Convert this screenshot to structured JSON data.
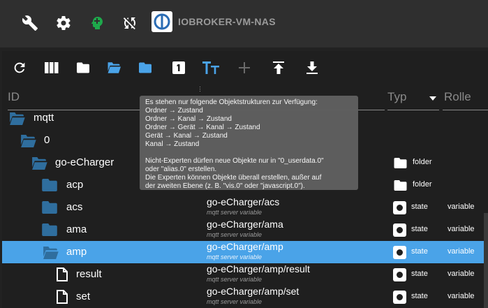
{
  "topbar": {
    "icons": [
      "wrench-icon",
      "gear-icon",
      "head-profile-icon",
      "sync-disabled-icon"
    ],
    "title": "IOBROKER-VM-NAS"
  },
  "toolbar": {
    "buttons": [
      "refresh-icon",
      "columns-icon",
      "folder-closed-icon",
      "folder-open-icon",
      "folder-icon",
      "number-one-icon",
      "text-size-icon",
      "add-icon",
      "upload-icon",
      "download-icon"
    ]
  },
  "header": {
    "id": "ID",
    "typ": "Typ",
    "rolle": "Rolle"
  },
  "tooltip": {
    "lines": [
      "Es stehen nur folgende Objektstrukturen zur Verfügung:",
      "Ordner → Zustand",
      "Ordner → Kanal → Zustand",
      "Ordner → Gerät → Kanal → Zustand",
      "Gerät → Kanal → Zustand",
      "Kanal → Zustand",
      "",
      "Nicht-Experten dürfen neue Objekte nur in \"0_userdata.0\"",
      "oder \"alias.0\" erstellen.",
      "Die Experten können Objekte überall erstellen, außer auf",
      "der zweiten Ebene (z. B. \"vis.0\" oder \"javascript.0\")."
    ]
  },
  "rows": [
    {
      "label": "mqtt",
      "name": "",
      "desc": "",
      "type": "",
      "role": ""
    },
    {
      "label": "0",
      "name": "",
      "desc": "",
      "type": "",
      "role": ""
    },
    {
      "label": "go-eCharger",
      "name": "",
      "desc": "",
      "type": "folder",
      "role": ""
    },
    {
      "label": "acp",
      "name": "",
      "desc": "",
      "type": "folder",
      "role": ""
    },
    {
      "label": "acs",
      "name": "go-eCharger/acs",
      "desc": "mqtt server variable",
      "type": "state",
      "role": "variable"
    },
    {
      "label": "ama",
      "name": "go-eCharger/ama",
      "desc": "mqtt server variable",
      "type": "state",
      "role": "variable"
    },
    {
      "label": "amp",
      "name": "go-eCharger/amp",
      "desc": "mqtt server variable",
      "type": "state",
      "role": "variable"
    },
    {
      "label": "result",
      "name": "go-eCharger/amp/result",
      "desc": "mqtt server variable",
      "type": "state",
      "role": "variable"
    },
    {
      "label": "set",
      "name": "go-eCharger/amp/set",
      "desc": "mqtt server variable",
      "type": "state",
      "role": "variable"
    }
  ],
  "colors": {
    "accent": "#4aa3e8",
    "folder": "#2f6e9e",
    "selected_row": "#4aa3e8",
    "status_green": "#1ea84b"
  }
}
